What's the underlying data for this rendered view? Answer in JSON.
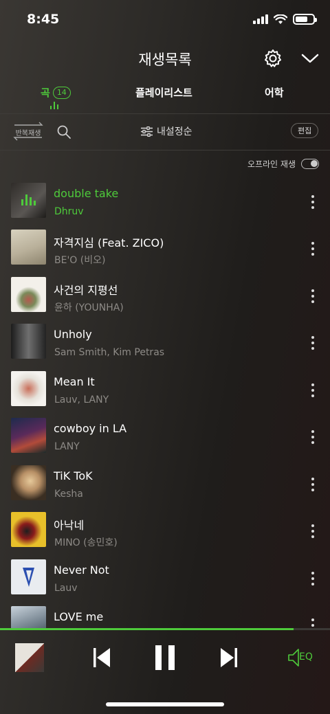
{
  "status_bar": {
    "time": "8:45"
  },
  "header": {
    "title": "재생목록"
  },
  "tabs": {
    "songs_label": "곡",
    "songs_count": "14",
    "playlist_label": "플레이리스트",
    "language_label": "어학"
  },
  "toolbar": {
    "repeat_label": "반복재생",
    "sort_label": "내설정순",
    "edit_label": "편집"
  },
  "offline": {
    "label": "오프라인 재생",
    "enabled": false
  },
  "songs": [
    {
      "title": "double take",
      "artist": "Dhruv",
      "playing": true
    },
    {
      "title": "자격지심 (Feat. ZICO)",
      "artist": "BE'O (비오)"
    },
    {
      "title": "사건의 지평선",
      "artist": "윤하 (YOUNHA)"
    },
    {
      "title": "Unholy",
      "artist": "Sam Smith, Kim Petras"
    },
    {
      "title": "Mean It",
      "artist": "Lauv, LANY"
    },
    {
      "title": "cowboy in LA",
      "artist": "LANY"
    },
    {
      "title": "TiK ToK",
      "artist": "Kesha"
    },
    {
      "title": "아낙네",
      "artist": "MINO (송민호)"
    },
    {
      "title": "Never Not",
      "artist": "Lauv"
    },
    {
      "title": "LOVE me",
      "artist": ""
    }
  ],
  "player": {
    "progress": 0.89,
    "eq_label": "EQ"
  },
  "colors": {
    "accent": "#4ecb3b",
    "muted_text": "#8e8b87"
  }
}
